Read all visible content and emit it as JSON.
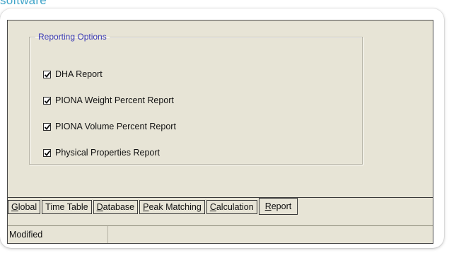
{
  "caption": "software",
  "group": {
    "title": "Reporting Options",
    "options": [
      {
        "label": "DHA Report",
        "checked": true
      },
      {
        "label": "PIONA Weight Percent Report",
        "checked": true
      },
      {
        "label": "PIONA Volume Percent Report",
        "checked": true
      },
      {
        "label": "Physical Properties Report",
        "checked": true
      }
    ]
  },
  "tabs": [
    {
      "mnemonic": "G",
      "rest": "lobal",
      "active": false
    },
    {
      "mnemonic": "",
      "rest": "Time Table",
      "active": false
    },
    {
      "mnemonic": "D",
      "rest": "atabase",
      "active": false
    },
    {
      "mnemonic": "P",
      "rest": "eak Matching",
      "active": false
    },
    {
      "mnemonic": "C",
      "rest": "alculation",
      "active": false
    },
    {
      "mnemonic": "R",
      "rest": "eport",
      "active": true
    }
  ],
  "status": {
    "text": "Modified"
  },
  "colors": {
    "window_bg": "#e7e4d6",
    "legend_text": "#3a3ab5",
    "caption_text": "#3fa4c9"
  }
}
